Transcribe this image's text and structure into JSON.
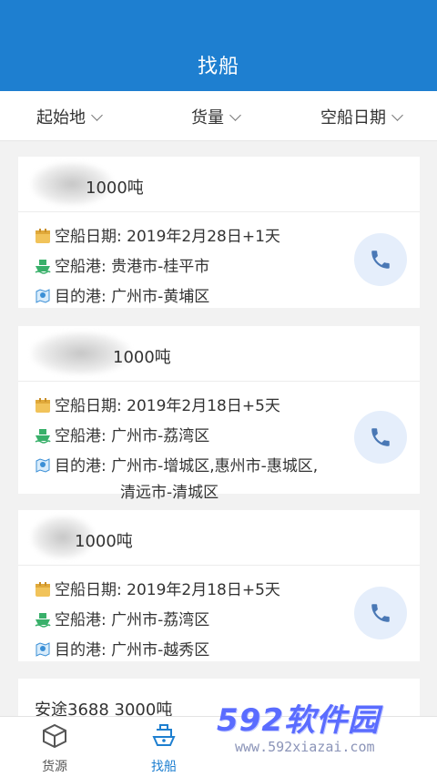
{
  "header": {
    "title": "找船"
  },
  "filters": [
    {
      "label": "起始地"
    },
    {
      "label": "货量"
    },
    {
      "label": "空船日期"
    }
  ],
  "cards": [
    {
      "name": "1000吨",
      "date_label": "空船日期:",
      "date": "2019年2月28日+1天",
      "port_label": "空船港:",
      "port": "贵港市-桂平市",
      "dest_label": "目的港:",
      "dest": "广州市-黄埔区",
      "dest_cont": ""
    },
    {
      "name": "1000吨",
      "date_label": "空船日期:",
      "date": "2019年2月18日+5天",
      "port_label": "空船港:",
      "port": "广州市-荔湾区",
      "dest_label": "目的港:",
      "dest": "广州市-增城区,惠州市-惠城区,",
      "dest_cont": "清远市-清城区"
    },
    {
      "name": "1000吨",
      "date_label": "空船日期:",
      "date": "2019年2月18日+5天",
      "port_label": "空船港:",
      "port": "广州市-荔湾区",
      "dest_label": "目的港:",
      "dest": "广州市-越秀区",
      "dest_cont": ""
    },
    {
      "name": "安途3688  3000吨"
    }
  ],
  "tabbar": [
    {
      "label": "货源",
      "icon": "cargo-box-icon"
    },
    {
      "label": "找船",
      "icon": "ship-icon"
    }
  ],
  "watermark": {
    "big": "592软件园",
    "small": "www.592xiazai.com"
  },
  "colors": {
    "primary": "#1e7fd0",
    "call_bg": "#e5eefb",
    "call_icon": "#4a78b5"
  }
}
